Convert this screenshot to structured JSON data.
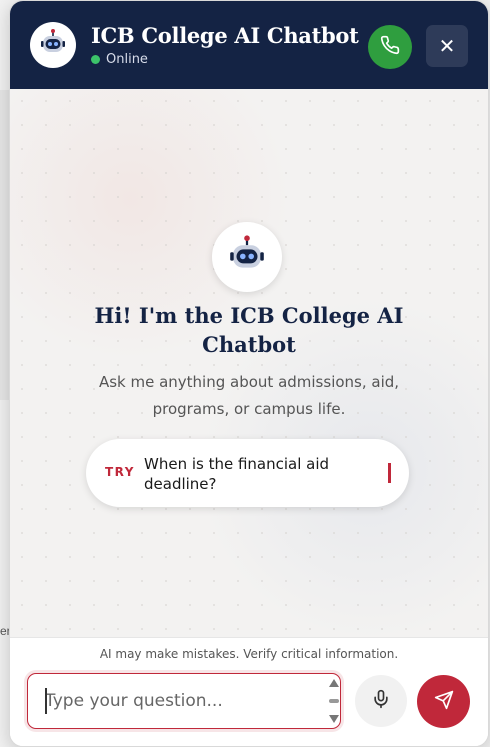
{
  "background": {
    "fragment_text": "er"
  },
  "header": {
    "title": "ICB College AI Chatbot",
    "status": "Online",
    "avatar_icon": "robot-icon",
    "call_icon": "phone-icon",
    "close_icon": "close-icon",
    "close_glyph": "✕"
  },
  "welcome": {
    "greeting": "Hi! I'm the ICB College AI Chatbot",
    "subtitle": "Ask me anything about admissions, aid, programs, or campus life.",
    "suggestion": {
      "label": "TRY",
      "text": "When is the financial aid deadline?"
    }
  },
  "footer": {
    "disclaimer": "AI may make mistakes. Verify critical information.",
    "input_placeholder": "Type your question...",
    "input_value": "",
    "mic_icon": "microphone-icon",
    "send_icon": "send-icon"
  },
  "colors": {
    "header_bg": "#142344",
    "accent": "#c0283a",
    "call_green": "#2f9e3f",
    "online_dot": "#3cc36a"
  }
}
